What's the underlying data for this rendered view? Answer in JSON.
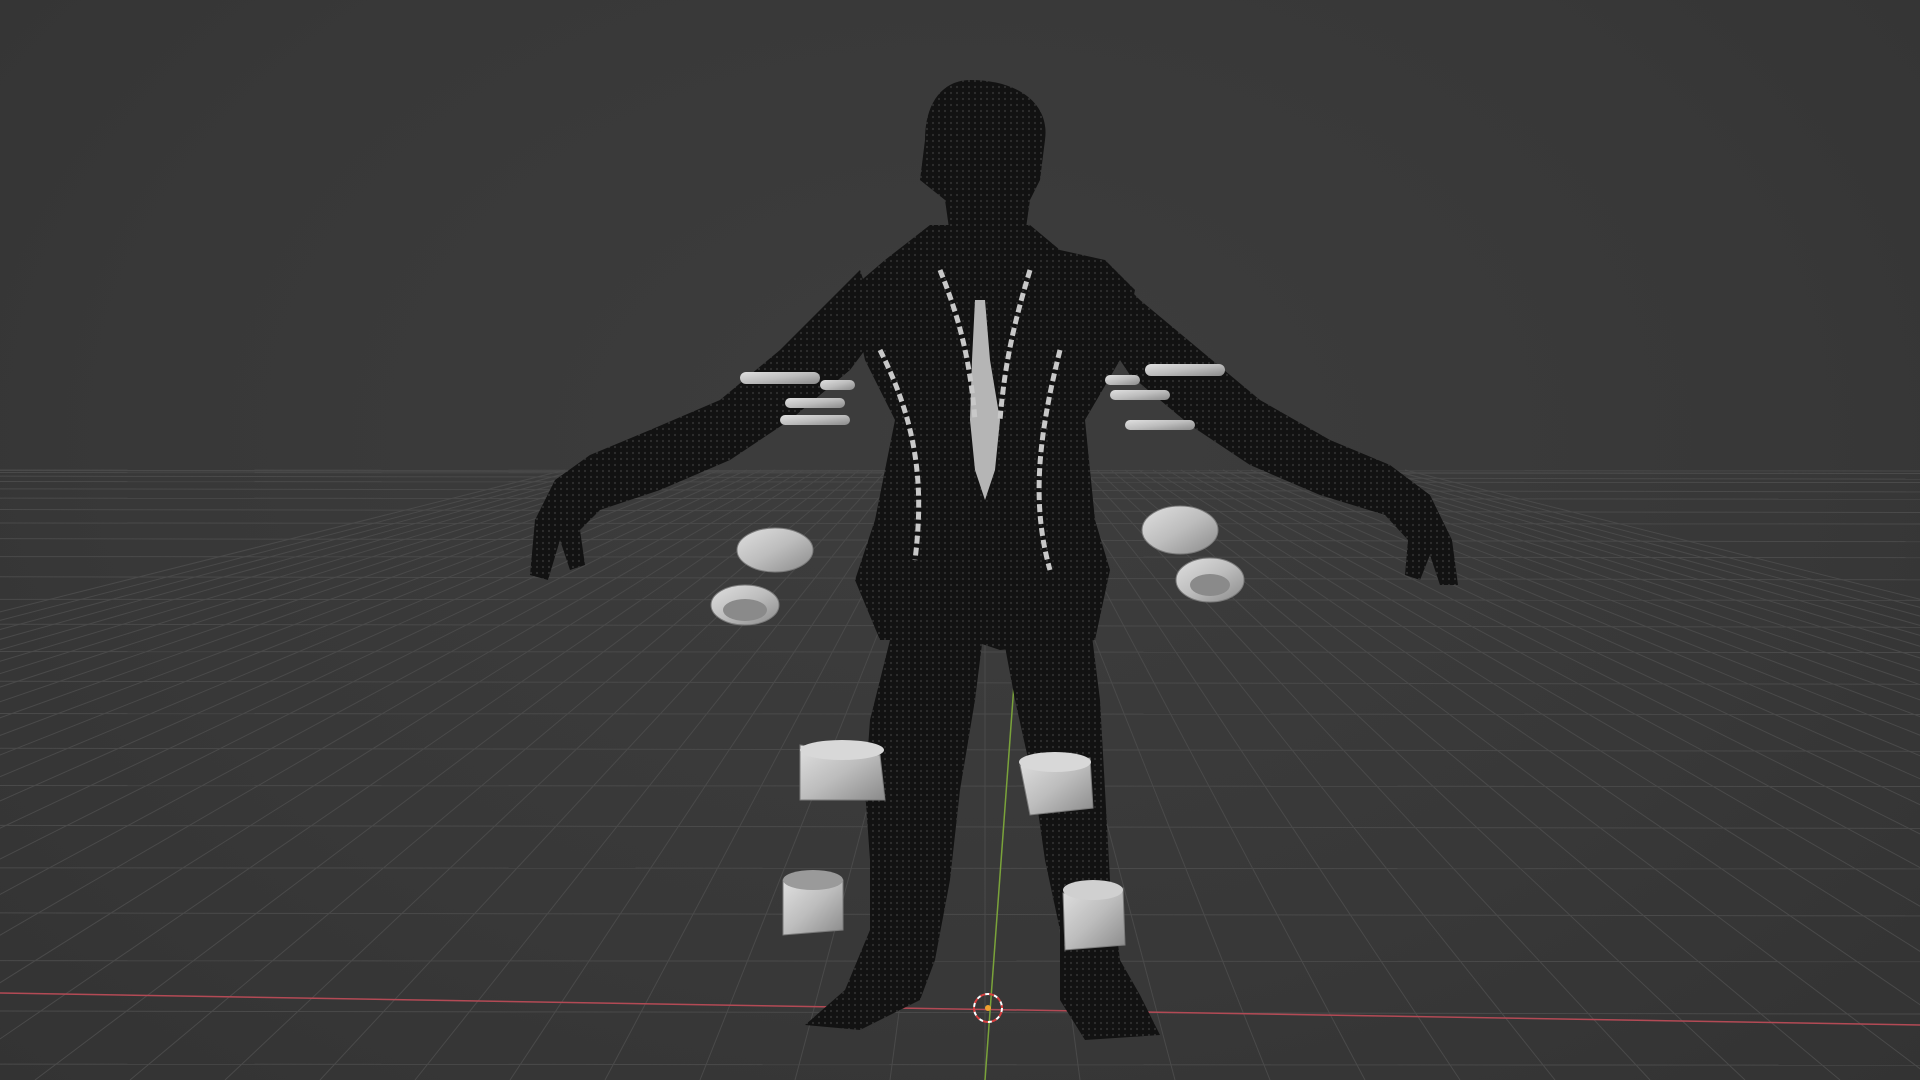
{
  "viewport": {
    "name": "3d-viewport",
    "background": "#3a3a3a",
    "grid_color": "#4a4a4a",
    "x_axis_color": "#b34a55",
    "y_axis_color": "#7aa33a",
    "mesh_color": "#0e0e0e",
    "props_color": "#c4c4c4"
  },
  "scene": {
    "model": "character-mesh",
    "props": [
      "arm-bolts-left",
      "arm-bolts-right",
      "wrist-cuff-left",
      "wrist-cuff-right",
      "thigh-band-left",
      "thigh-band-right",
      "ankle-cuff-left",
      "ankle-cuff-right",
      "chest-chains"
    ],
    "origin": "3d-cursor-icon"
  }
}
